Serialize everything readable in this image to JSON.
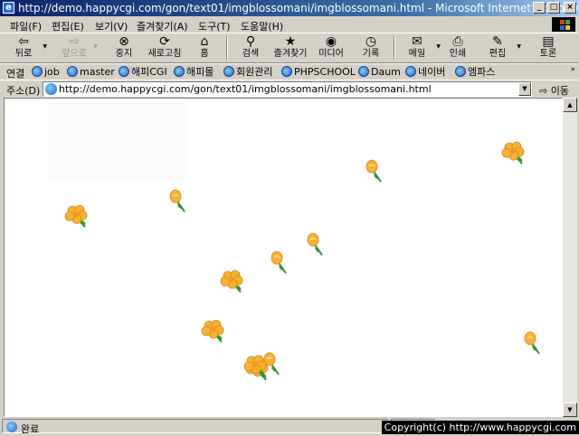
{
  "window": {
    "title": "http://demo.happycgi.com/gon/text01/imgblossomani/imgblossomani.html - Microsoft Internet Explorer",
    "app_icon": "e",
    "buttons": [
      "_",
      "□",
      "×"
    ]
  },
  "menu": [
    "파일(F)",
    "편집(E)",
    "보기(V)",
    "즐겨찾기(A)",
    "도구(T)",
    "도움말(H)"
  ],
  "toolbar": {
    "back": {
      "label": "뒤로",
      "icon": "back-arrow-icon"
    },
    "forward": {
      "label": "앞으로",
      "icon": "forward-arrow-icon"
    },
    "stop": {
      "label": "중지",
      "icon": "stop-icon"
    },
    "refresh": {
      "label": "새로고침",
      "icon": "refresh-icon"
    },
    "home": {
      "label": "홈",
      "icon": "home-icon"
    },
    "search": {
      "label": "검색",
      "icon": "search-icon"
    },
    "favorites": {
      "label": "즐겨찾기",
      "icon": "favorites-icon"
    },
    "media": {
      "label": "미디어",
      "icon": "media-icon"
    },
    "history": {
      "label": "기록",
      "icon": "history-icon"
    },
    "mail": {
      "label": "메일",
      "icon": "mail-icon"
    },
    "print": {
      "label": "인쇄",
      "icon": "print-icon"
    },
    "edit": {
      "label": "편집",
      "icon": "edit-icon"
    },
    "discuss": {
      "label": "토론",
      "icon": "discuss-icon"
    }
  },
  "links": {
    "label": "연결",
    "items": [
      "job",
      "master",
      "해피CGI",
      "해피몰",
      "회원관리",
      "PHPSCHOOL",
      "Daum",
      "네이버",
      "엠파스"
    ],
    "more": "»"
  },
  "address": {
    "label": "주소(D)",
    "url": "http://demo.happycgi.com/gon/text01/imgblossomani/imgblossomani.html",
    "go_label": "이동"
  },
  "content": {
    "flowers": [
      {
        "kind": "open"
      },
      {
        "kind": "open"
      },
      {
        "kind": "open"
      },
      {
        "kind": "bud"
      },
      {
        "kind": "bud"
      },
      {
        "kind": "bud"
      },
      {
        "kind": "open"
      },
      {
        "kind": "open"
      },
      {
        "kind": "bud"
      },
      {
        "kind": "open"
      },
      {
        "kind": "bud"
      },
      {
        "kind": "bud"
      }
    ]
  },
  "status": {
    "text": "완료",
    "copyright": "Copyright(c) http://www.happycgi.com"
  },
  "colors": {
    "titlebar_start": "#0a246a",
    "titlebar_end": "#a6caf0",
    "chrome": "#d4d0c8",
    "petal": "#f7b233",
    "petal_dark": "#e0851a",
    "leaf": "#2e9a2e"
  }
}
